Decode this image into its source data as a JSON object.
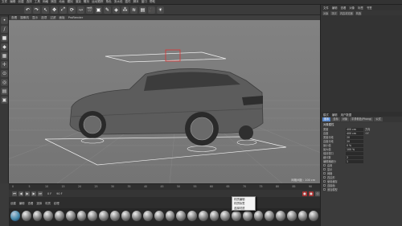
{
  "menubar": [
    "文件",
    "编辑",
    "创建",
    "选择",
    "工具",
    "网格",
    "捕捉",
    "动画",
    "模拟",
    "渲染",
    "雕刻",
    "运动跟踪",
    "角色",
    "流水线",
    "插件",
    "脚本",
    "窗口",
    "帮助"
  ],
  "viewport": {
    "menu": [
      "查看",
      "摄像机",
      "显示",
      "选项",
      "过滤",
      "面板",
      "ProRender"
    ],
    "grid_label": "网格间距 : 100 cm"
  },
  "toolbar_icons": [
    "undo-icon",
    "redo-icon",
    "select-icon",
    "move-icon",
    "scale-icon",
    "rotate-icon",
    "xyz-icon",
    "render-icon",
    "cube-icon",
    "pen-icon",
    "subdivide-icon",
    "clone-icon",
    "deform-icon",
    "scene-icon",
    "camera-icon",
    "light-icon"
  ],
  "timeline": {
    "ticks": [
      "0",
      "5",
      "10",
      "15",
      "20",
      "25",
      "30",
      "35",
      "40",
      "45",
      "50",
      "55",
      "60",
      "65",
      "70",
      "75",
      "80",
      "85",
      "90"
    ],
    "start": "0 F",
    "end": "90 F"
  },
  "material_manager": {
    "menu": [
      "创建",
      "编辑",
      "查看",
      "选择",
      "材质",
      "纹理"
    ],
    "swatch_count": 28
  },
  "popup": {
    "items": [
      "材质编辑",
      "材质标签",
      "选择材质"
    ]
  },
  "object_manager": {
    "menu": [
      "文件",
      "编辑",
      "查看",
      "对象",
      "标签",
      "书签"
    ],
    "tabs": [
      "对象",
      "场次",
      "内容浏览器",
      "构造"
    ]
  },
  "attributes": {
    "menu": [
      "模式",
      "编辑",
      "用户数据"
    ],
    "tabs": [
      "基本",
      "坐标",
      "对象",
      "平滑着色(Phong)",
      "公式"
    ],
    "section": "对象属性",
    "rows": [
      {
        "label": "宽度",
        "value": "400 cm",
        "extra": "方向"
      },
      {
        "label": "高度",
        "value": "400 cm",
        "extra": "+Y"
      },
      {
        "label": "宽度分段",
        "value": "20"
      },
      {
        "label": "高度分段",
        "value": "20"
      },
      {
        "label": "最小值",
        "value": "0 %"
      },
      {
        "label": "最大值",
        "value": "100 %"
      },
      {
        "label": "保持视口",
        "value": ""
      },
      {
        "label": "细分数",
        "value": "2"
      },
      {
        "label": "编辑器细分",
        "value": "1"
      }
    ],
    "toggles": [
      "启用",
      "显示",
      "网格",
      "四边形",
      "使用缓存",
      "连接面",
      "追加模型"
    ]
  }
}
